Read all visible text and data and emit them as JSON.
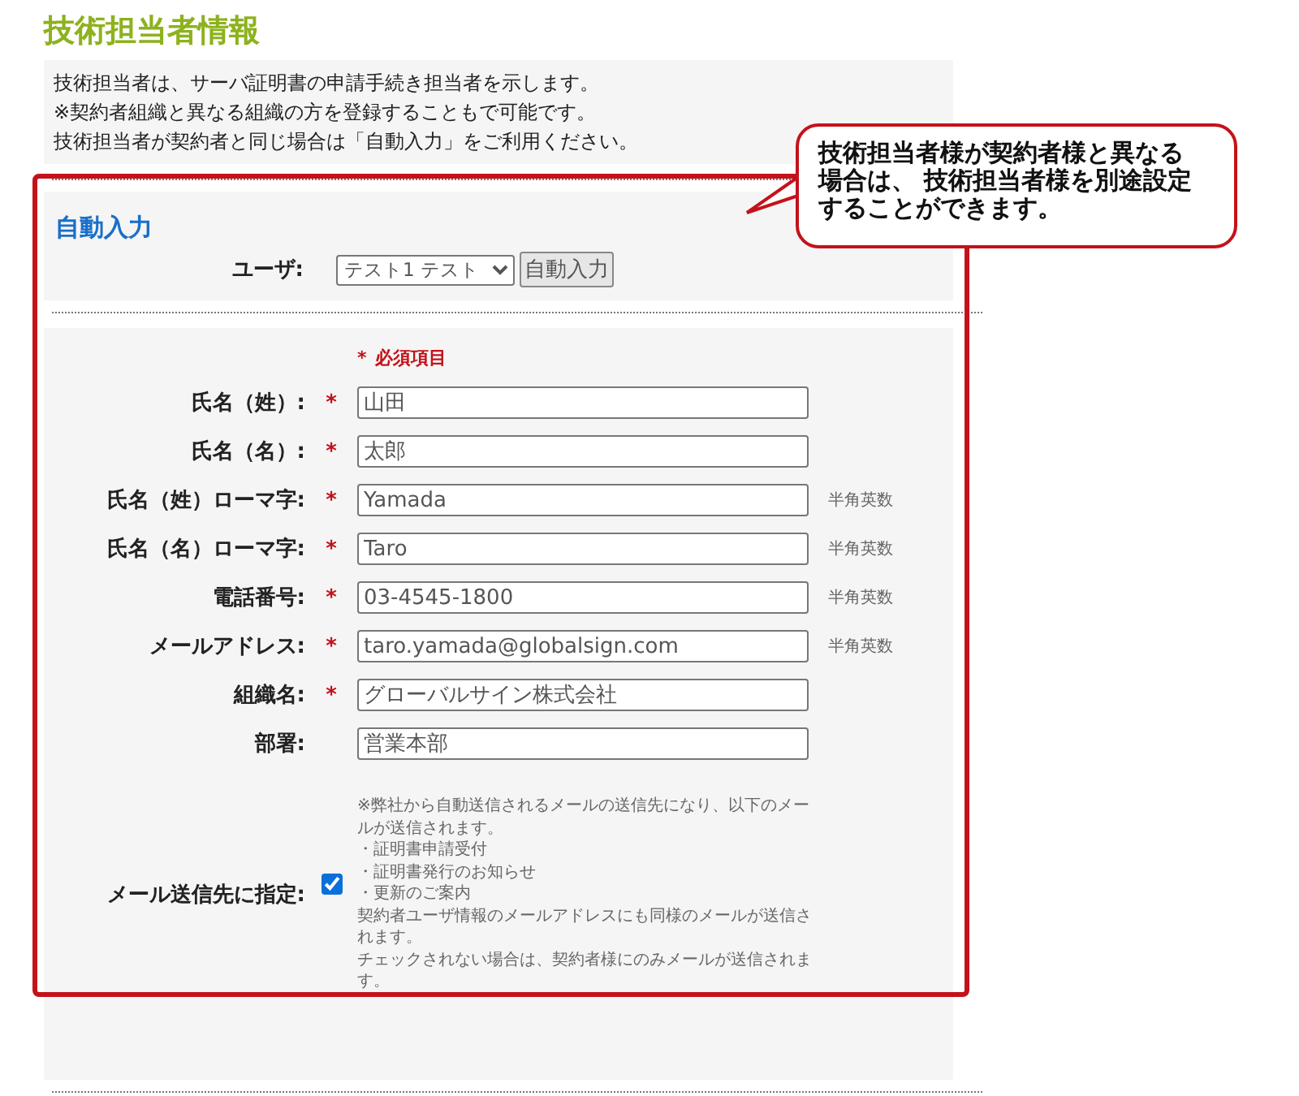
{
  "title": "技術担当者情報",
  "intro": [
    "技術担当者は、サーバ証明書の申請手続き担当者を示します。",
    "※契約者組織と異なる組織の方を登録することもで可能です。",
    "技術担当者が契約者と同じ場合は「自動入力」をご利用ください。"
  ],
  "auto_fill": {
    "heading": "自動入力",
    "user_label": "ユーザ:",
    "user_select": "テスト1 テスト",
    "button": "自動入力"
  },
  "required_note": {
    "mark": "*",
    "text": "必須項目"
  },
  "fields": [
    {
      "label": "氏名（姓）:",
      "mark": "*",
      "value": "山田"
    },
    {
      "label": "氏名（名）:",
      "mark": "*",
      "value": "太郎"
    },
    {
      "label": "氏名（姓）ローマ字:",
      "mark": "*",
      "value": "Yamada",
      "note": "半角英数"
    },
    {
      "label": "氏名（名）ローマ字:",
      "mark": "*",
      "value": "Taro",
      "note": "半角英数"
    },
    {
      "label": "電話番号:",
      "mark": "*",
      "value": "03-4545-1800",
      "note": "半角英数"
    },
    {
      "label": "メールアドレス:",
      "mark": "*",
      "value": "taro.yamada@globalsign.com",
      "note": "半角英数"
    },
    {
      "label": "組織名:",
      "mark": "*",
      "value": "グローバルサイン株式会社"
    },
    {
      "label": "部署:",
      "value": "営業本部"
    }
  ],
  "mail_option": {
    "label": "メール送信先に指定:",
    "checked": true,
    "notes": [
      "※弊社から自動送信されるメールの送信先になり、以下のメールが送信されます。",
      "・証明書申請受付",
      "・証明書発行のお知らせ",
      "・更新のご案内",
      "契約者ユーザ情報のメールアドレスにも同様のメールが送信されます。",
      "チェックされない場合は、契約者様にのみメールが送信されます。"
    ]
  },
  "callout": {
    "text": "技術担当者様が契約者様と異なる場合は、 技術担当者様を別途設定することができます。"
  }
}
